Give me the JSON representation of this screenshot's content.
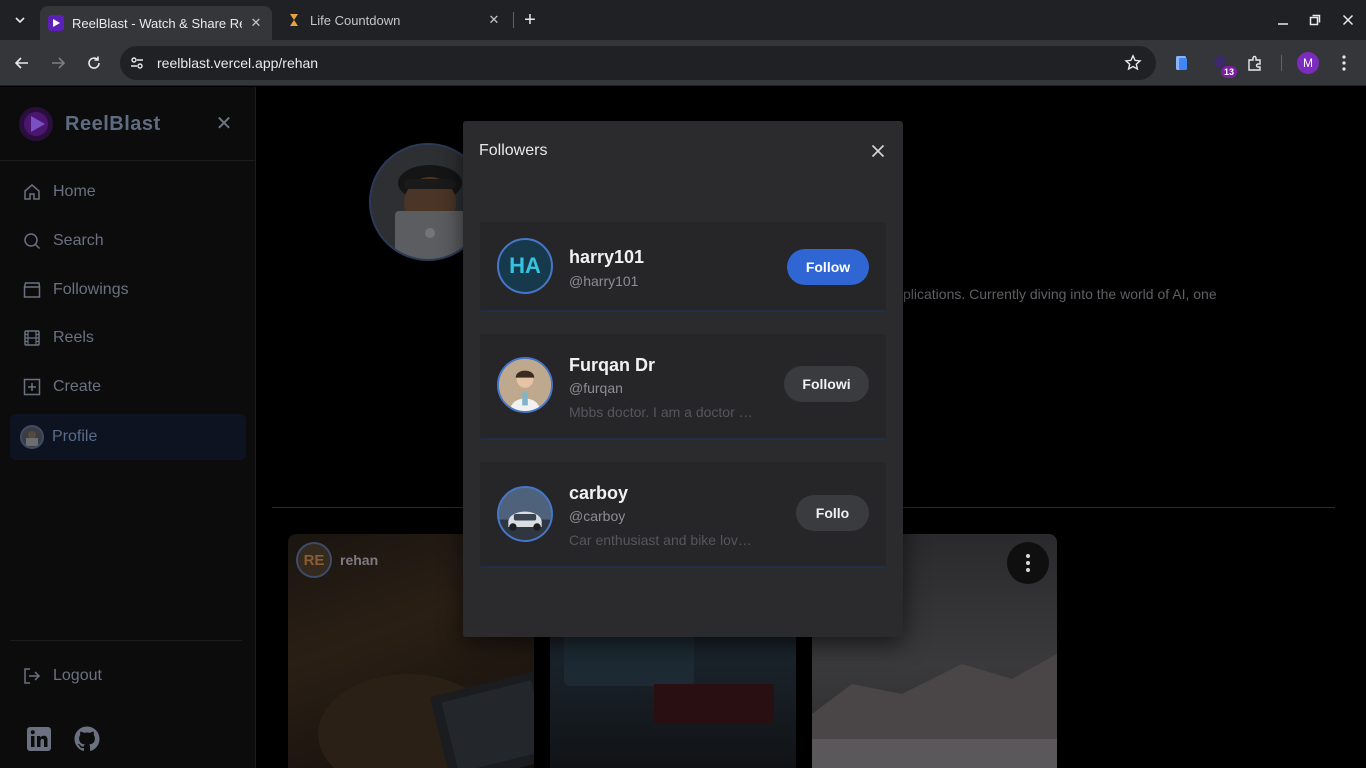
{
  "browser": {
    "tabs": [
      {
        "title": "ReelBlast - Watch & Share Re",
        "active": true
      },
      {
        "title": "Life Countdown",
        "active": false
      }
    ],
    "url": "reelblast.vercel.app/rehan",
    "extension_badge": "13",
    "profile_initial": "M"
  },
  "sidebar": {
    "brand": "ReelBlast",
    "items": [
      {
        "label": "Home",
        "icon": "home-icon"
      },
      {
        "label": "Search",
        "icon": "search-icon"
      },
      {
        "label": "Followings",
        "icon": "clapperboard-icon"
      },
      {
        "label": "Reels",
        "icon": "film-icon"
      },
      {
        "label": "Create",
        "icon": "plus-square-icon"
      },
      {
        "label": "Profile",
        "icon": "avatar",
        "active": true
      }
    ],
    "logout": "Logout"
  },
  "background": {
    "bio_fragment": "plications. Currently diving into the world of AI, one",
    "reels": [
      {
        "owner_initials": "RE",
        "owner_name": "rehan"
      }
    ]
  },
  "modal": {
    "title": "Followers",
    "followers": [
      {
        "initials": "HA",
        "name": "harry101",
        "handle": "@harry101",
        "bio": "",
        "button": "Follow",
        "button_style": "primary"
      },
      {
        "initials": "",
        "name": "Furqan Dr",
        "handle": "@furqan",
        "bio": "Mbbs doctor. I am a doctor …",
        "button": "Followi",
        "button_style": "secondary"
      },
      {
        "initials": "",
        "name": "carboy",
        "handle": "@carboy",
        "bio": "Car enthusiast and bike lover …",
        "button": "Follo",
        "button_style": "secondary"
      }
    ]
  },
  "colors": {
    "accent": "#2f66d4",
    "modal_bg": "#2b2b2d",
    "page_bg": "#000000"
  }
}
